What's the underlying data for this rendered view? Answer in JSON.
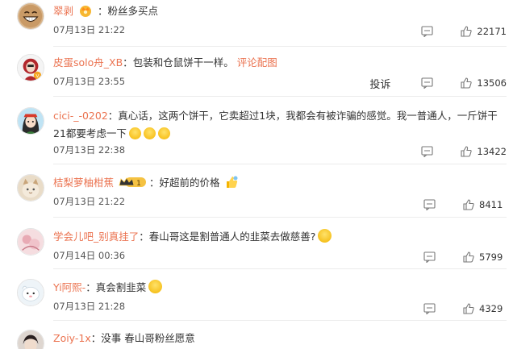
{
  "comments": [
    {
      "username": "翠剥",
      "text": "粉丝多买点",
      "time": "07月13日 21:22",
      "likes": "22171"
    },
    {
      "username": "皮蛋solo舟_XB",
      "text": "包装和仓鼠饼干一样。",
      "link": "评论配图",
      "time": "07月13日 23:55",
      "likes": "13506",
      "report": "投诉"
    },
    {
      "username": "cici-_-0202",
      "text": "真心话，这两个饼干，它卖超过1块，我都会有被诈骗的感觉。我一普通人，一斤饼干21都要考虑一下",
      "time": "07月13日 22:38",
      "likes": "13422"
    },
    {
      "username": "桔梨萝柚柑蕉",
      "text": "好超前的价格",
      "time": "07月13日 21:22",
      "likes": "8411"
    },
    {
      "username": "学会儿吧_别真挂了",
      "text": "春山哥这是割普通人的韭菜去做慈善?",
      "time": "07月14日 00:36",
      "likes": "5799"
    },
    {
      "username": "Yi阿熙-",
      "text": "真会割韭菜",
      "time": "07月13日 21:28",
      "likes": "4329"
    },
    {
      "username": "Zoiy-1x",
      "text": "没事 春山哥粉丝愿意"
    }
  ],
  "badge_text": "1",
  "colors": {
    "username": "#eb7350",
    "text": "#333333",
    "meta": "#555555"
  }
}
